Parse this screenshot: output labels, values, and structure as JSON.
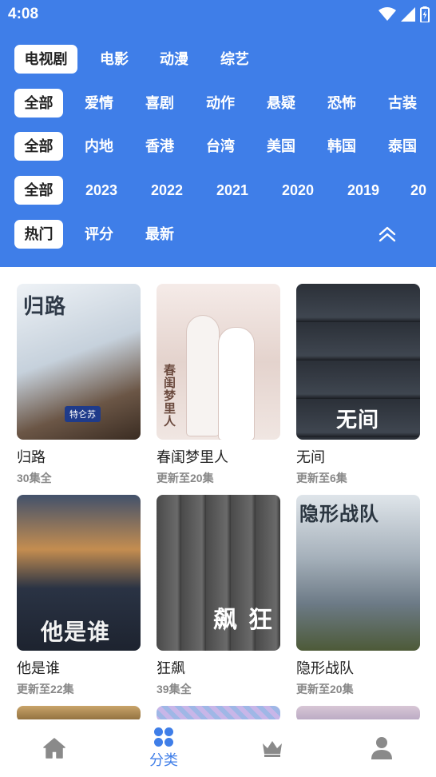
{
  "status": {
    "time": "4:08"
  },
  "tabs": {
    "category": [
      "电视剧",
      "电影",
      "动漫",
      "综艺"
    ],
    "genre": [
      "全部",
      "爱情",
      "喜剧",
      "动作",
      "悬疑",
      "恐怖",
      "古装"
    ],
    "region": [
      "全部",
      "内地",
      "香港",
      "台湾",
      "美国",
      "韩国",
      "泰国"
    ],
    "year": [
      "全部",
      "2023",
      "2022",
      "2021",
      "2020",
      "2019",
      "20"
    ],
    "sort": [
      "热门",
      "评分",
      "最新"
    ]
  },
  "cards": [
    {
      "title": "归路",
      "sub": "30集全",
      "poster_text": "归路",
      "poster_badge": "特仑苏",
      "colors": [
        "#e9eef3",
        "#b9c6d3",
        "#4b3a2d"
      ]
    },
    {
      "title": "春闺梦里人",
      "sub": "更新至20集",
      "poster_text": "春闺梦里人",
      "colors": [
        "#f3e7e4",
        "#e3cfc9",
        "#c9a9a2"
      ]
    },
    {
      "title": "无间",
      "sub": "更新至6集",
      "poster_text": "无间",
      "colors": [
        "#2a2f36",
        "#3d444d",
        "#15181c"
      ]
    },
    {
      "title": "他是谁",
      "sub": "更新至22集",
      "poster_text": "他是谁",
      "colors": [
        "#3b4a63",
        "#c58a4a",
        "#1f2633"
      ]
    },
    {
      "title": "狂飙",
      "sub": "39集全",
      "poster_text": "狂飙",
      "colors": [
        "#5a5a5a",
        "#3a3a3a",
        "#8a8a8a"
      ]
    },
    {
      "title": "隐形战队",
      "sub": "更新至20集",
      "poster_text": "隐形战队",
      "colors": [
        "#cfd6dc",
        "#8e9aa5",
        "#5a6b3c"
      ]
    }
  ],
  "nav": {
    "category_label": "分类"
  },
  "colors": {
    "accent": "#3f7ee8"
  }
}
